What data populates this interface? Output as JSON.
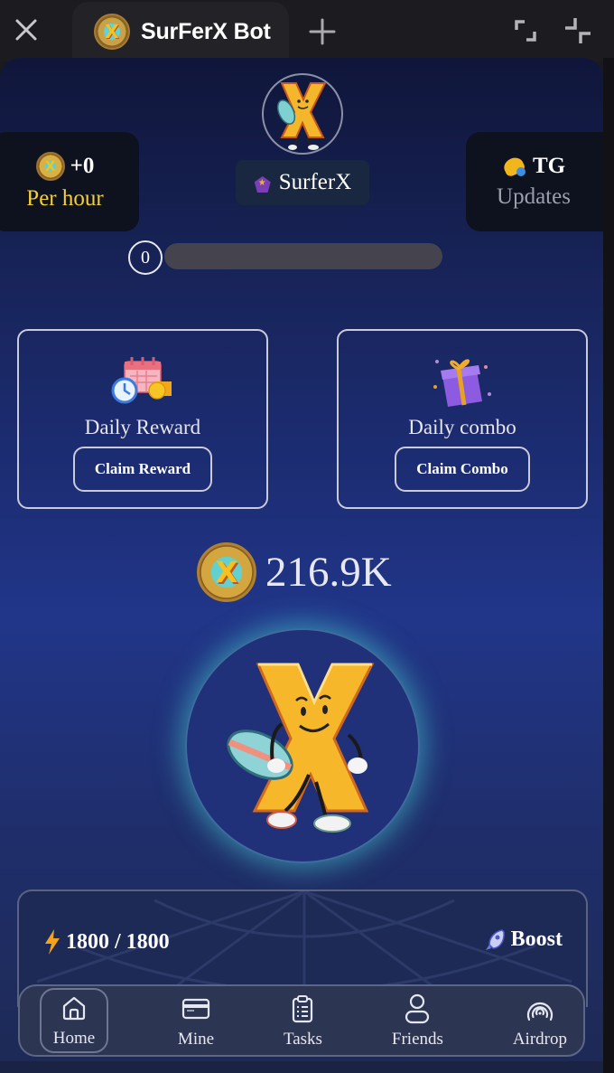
{
  "window": {
    "tab_title": "SurFerX Bot",
    "controls": [
      "close-icon",
      "new-tab-icon",
      "expand-icon",
      "collapse-icon"
    ]
  },
  "header": {
    "profit": {
      "value": "+0",
      "label": "Per hour",
      "icon": "coin-icon"
    },
    "profile": {
      "name": "SurferX",
      "rank_icon": "rank-badge-icon"
    },
    "updates": {
      "value": "TG",
      "label": "Updates",
      "icon": "bell-icon"
    },
    "level": {
      "value": "0",
      "progress_percent": 0
    }
  },
  "daily": [
    {
      "title": "Daily Reward",
      "button": "Claim Reward",
      "icon": "calendar-icon"
    },
    {
      "title": "Daily combo",
      "button": "Claim Combo",
      "icon": "gift-icon"
    }
  ],
  "balance": {
    "value": "216.9K",
    "icon": "coin-icon"
  },
  "energy": {
    "value": "1800 / 1800",
    "current": 1800,
    "max": 1800,
    "icon": "lightning-icon"
  },
  "boost": {
    "label": "Boost",
    "icon": "rocket-icon"
  },
  "nav": [
    {
      "label": "Home",
      "icon": "home-icon",
      "active": true
    },
    {
      "label": "Mine",
      "icon": "card-icon",
      "active": false
    },
    {
      "label": "Tasks",
      "icon": "clipboard-icon",
      "active": false
    },
    {
      "label": "Friends",
      "icon": "user-icon",
      "active": false
    },
    {
      "label": "Airdrop",
      "icon": "airdrop-icon",
      "active": false
    }
  ],
  "colors": {
    "accent_gold": "#f2cf3b",
    "glow_teal": "#46c8cd",
    "bg_navy": "#1e2f7a"
  }
}
